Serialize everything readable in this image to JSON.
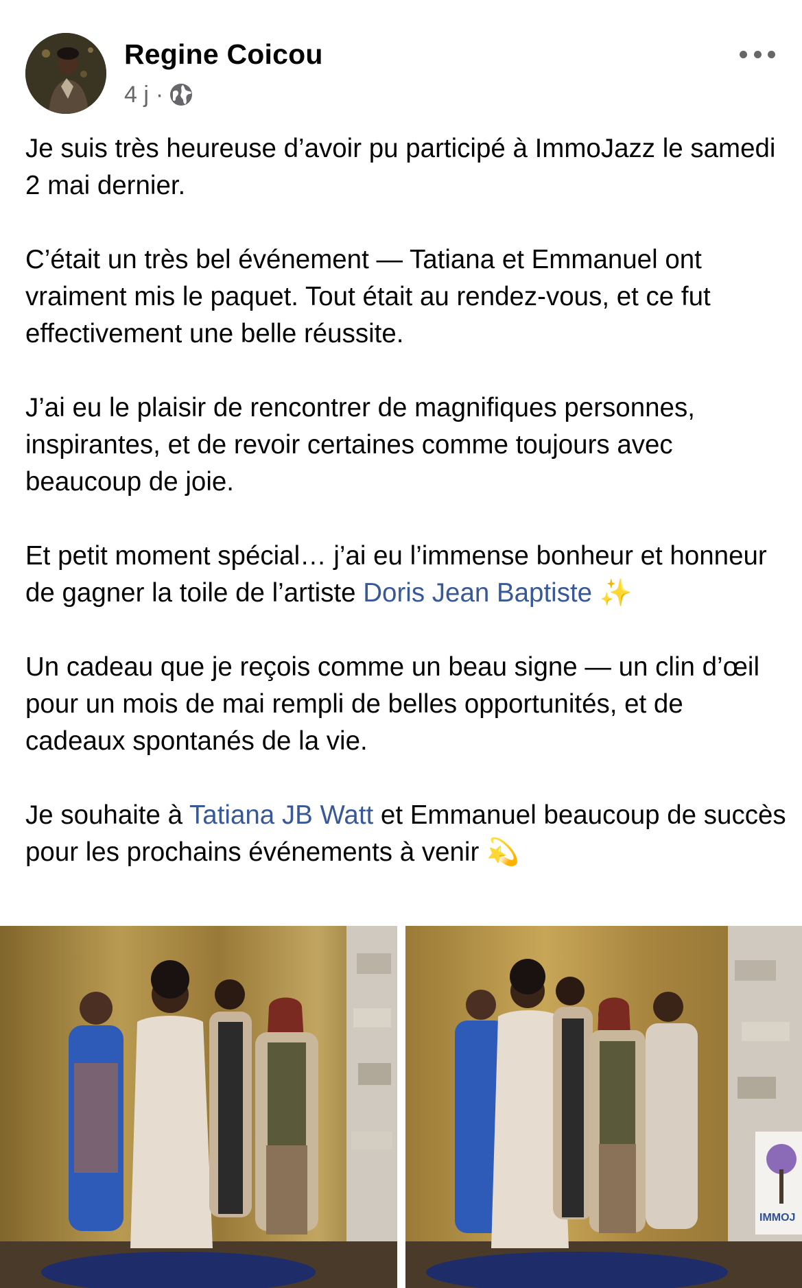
{
  "post": {
    "author": "Regine Coicou",
    "time": "4 j",
    "separator": "·",
    "audience_icon": "globe-icon",
    "more_icon": "more-horizontal-icon"
  },
  "text": {
    "p1": "Je suis très heureuse d’avoir pu participé à ImmoJazz le samedi 2 mai dernier.",
    "p2": "C’était un très bel événement — Tatiana et Emmanuel ont vraiment mis le paquet. Tout était au rendez-vous, et ce fut effectivement une belle réussite.",
    "p3": "J’ai eu le plaisir de rencontrer de magnifiques personnes, inspirantes, et de revoir certaines comme toujours avec beaucoup de joie.",
    "p4_before": "Et petit moment spécial… j’ai eu l’immense bonheur et honneur de gagner la toile de l’artiste ",
    "p4_link": "Doris Jean Baptiste",
    "p4_emoji": "✨",
    "p5": "Un cadeau que je reçois comme un beau signe — un clin d’œil pour un mois de mai rempli de belles opportunités, et de cadeaux spontanés de la vie.",
    "p6_before": "Je souhaite à ",
    "p6_link": "Tatiana JB Watt",
    "p6_after": " et Emmanuel beaucoup de succès pour les prochains événements à venir ",
    "p6_emoji": "💫"
  },
  "photos": [
    {
      "people": 4,
      "sign_text": ""
    },
    {
      "people": 5,
      "sign_text": "IMMOJ"
    }
  ],
  "colors": {
    "link": "#385898",
    "meta": "#65676b",
    "text": "#050505",
    "gold": "#b8953e"
  }
}
